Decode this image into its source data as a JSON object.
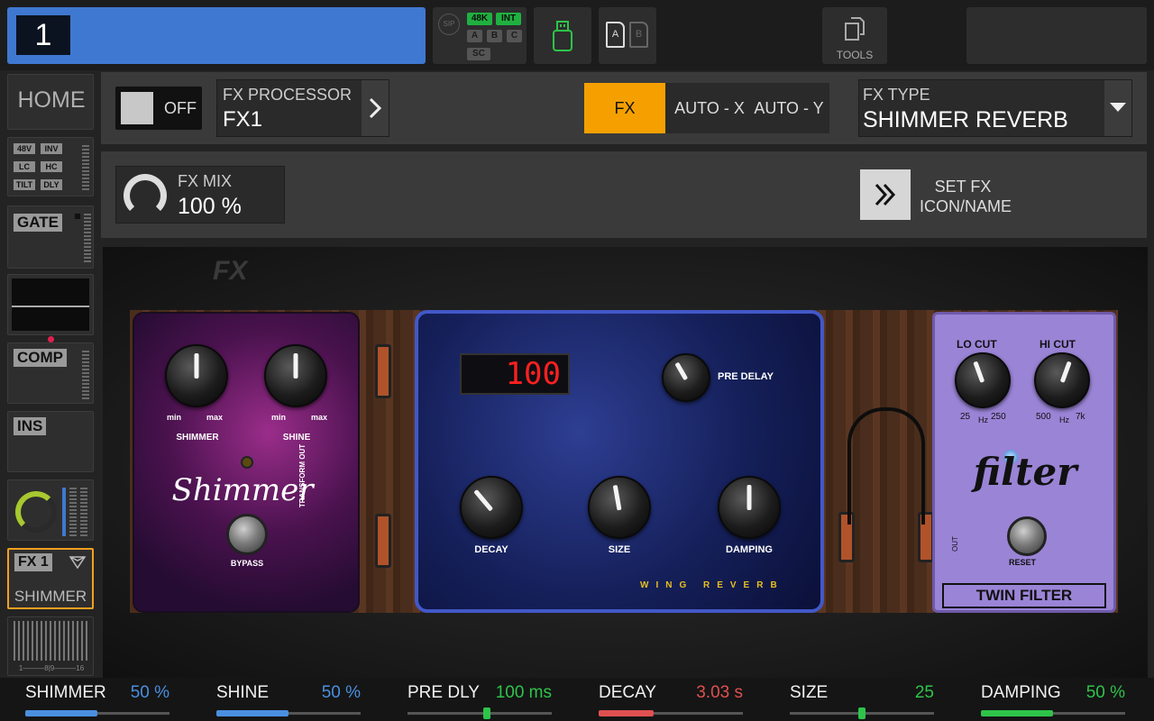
{
  "topbar": {
    "channel_number": "1",
    "sip_label": "SIP",
    "rate_48k": "48K",
    "clock_int": "INT",
    "slot_a": "A",
    "slot_b": "B",
    "slot_c": "C",
    "sc_label": "SC",
    "card_a": "A",
    "card_b": "B",
    "tools_label": "TOOLS"
  },
  "sidebar": {
    "home_label": "HOME",
    "filter_tags": [
      "48V",
      "INV",
      "LC",
      "HC",
      "TILT",
      "DLY"
    ],
    "gate_label": "GATE",
    "comp_label": "COMP",
    "ins_label": "INS",
    "fx_slot_label": "FX 1",
    "fx_slot_name": "SHIMMER",
    "meter_scale": "1———8|9———16"
  },
  "header": {
    "toggle_state": "OFF",
    "processor_label": "FX PROCESSOR",
    "processor_value": "FX1",
    "mode_fx": "FX",
    "mode_auto_x": "AUTO - X",
    "mode_auto_y": "AUTO - Y",
    "fx_type_label": "FX TYPE",
    "fx_type_value": "SHIMMER REVERB",
    "fx_mix_label": "FX MIX",
    "fx_mix_value": "100 %",
    "set_fx_line1": "SET FX",
    "set_fx_line2": "ICON/NAME"
  },
  "board": {
    "fx_logo": "FX",
    "shimmer": {
      "knob1_label": "SHIMMER",
      "knob2_label": "SHINE",
      "min": "min",
      "max": "max",
      "title": "Shimmer",
      "bypass": "BYPASS",
      "side_text": "TRANSFORM OUT"
    },
    "reverb": {
      "display": "100",
      "predelay_label": "PRE DELAY",
      "decay_label": "DECAY",
      "size_label": "SIZE",
      "damping_label": "DAMPING",
      "brand": "WING REVERB"
    },
    "filter": {
      "lo_cut": "LO CUT",
      "hi_cut": "HI CUT",
      "lo_min": "25",
      "lo_unit": "Hz",
      "lo_max": "250",
      "hi_min": "500",
      "hi_unit": "Hz",
      "hi_max": "7k",
      "logo": "filter",
      "reset": "RESET",
      "out": "OUT",
      "name": "TWIN FILTER"
    }
  },
  "params": [
    {
      "name": "SHIMMER",
      "value": "50 %",
      "color": "#4a8fe0",
      "level": 0.5,
      "style": "fill"
    },
    {
      "name": "SHINE",
      "value": "50 %",
      "color": "#4a8fe0",
      "level": 0.5,
      "style": "fill"
    },
    {
      "name": "PRE DLY",
      "value": "100 ms",
      "color": "#2ec44a",
      "level": 0.55,
      "style": "dot"
    },
    {
      "name": "DECAY",
      "value": "3.03 s",
      "color": "#e05050",
      "level": 0.38,
      "style": "fill"
    },
    {
      "name": "SIZE",
      "value": "25",
      "color": "#2ec44a",
      "level": 0.5,
      "style": "dot"
    },
    {
      "name": "DAMPING",
      "value": "50 %",
      "color": "#2ec44a",
      "level": 0.5,
      "style": "fill"
    }
  ],
  "colors": {
    "accent_blue": "#3f78d0",
    "fx_active": "#f5a000",
    "slot_highlight": "#f0a020"
  }
}
